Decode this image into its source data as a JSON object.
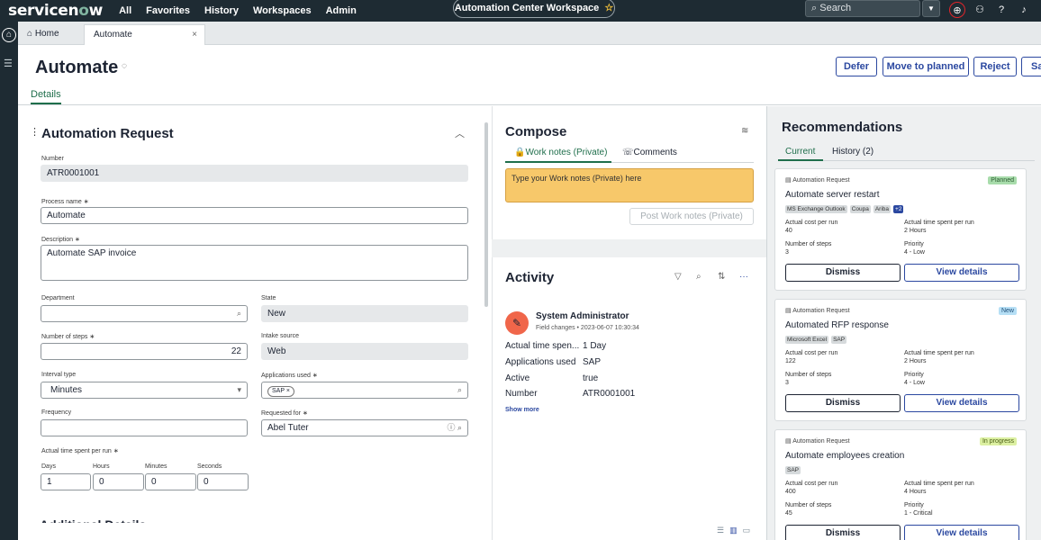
{
  "topnav": {
    "logo_prefix": "servicen",
    "logo_o": "o",
    "logo_suffix": "w",
    "links": [
      "All",
      "Favorites",
      "History",
      "Workspaces",
      "Admin"
    ],
    "workspace": "Automation Center Workspace",
    "star": "☆",
    "search_placeholder": "Search",
    "icons": [
      "globe-icon",
      "chat-icon",
      "help-icon",
      "bell-icon"
    ]
  },
  "tabs": {
    "home": "Home",
    "active": "Automate",
    "close": "×"
  },
  "header": {
    "title": "Automate",
    "buttons": [
      "Defer",
      "Move to planned",
      "Reject",
      "Sa"
    ],
    "details_tab": "Details"
  },
  "form": {
    "section_title": "Automation Request",
    "number_label": "Number",
    "number_value": "ATR0001001",
    "process_label": "Process name",
    "process_value": "Automate",
    "description_label": "Description",
    "description_value": "Automate SAP invoice",
    "department_label": "Department",
    "department_value": "",
    "state_label": "State",
    "state_value": "New",
    "steps_label": "Number of steps",
    "steps_value": "22",
    "intake_label": "Intake source",
    "intake_value": "Web",
    "interval_label": "Interval type",
    "interval_value": "Minutes",
    "apps_label": "Applications used",
    "apps_chip": "SAP",
    "frequency_label": "Frequency",
    "frequency_value": "",
    "requested_label": "Requested for",
    "requested_value": "Abel Tuter",
    "actual_label": "Actual time spent per run",
    "days_label": "Days",
    "days_value": "1",
    "hours_label": "Hours",
    "hours_value": "0",
    "minutes_label": "Minutes",
    "minutes_value": "0",
    "seconds_label": "Seconds",
    "seconds_value": "0",
    "next_section": "Additional Details",
    "required_mark": "∗"
  },
  "compose": {
    "title": "Compose",
    "tab_work_notes": "Work notes (Private)",
    "tab_comments": "Comments",
    "placeholder": "Type your Work notes (Private) here",
    "post_button": "Post Work notes (Private)"
  },
  "activity": {
    "title": "Activity",
    "user": "System Administrator",
    "meta": "Field changes • 2023-06-07 10:30:34",
    "entries": [
      {
        "key": "Actual time spen...",
        "value": "1 Day"
      },
      {
        "key": "Applications used",
        "value": "SAP"
      },
      {
        "key": "Active",
        "value": "true"
      },
      {
        "key": "Number",
        "value": "ATR0001001"
      }
    ],
    "show_more": "Show more"
  },
  "recommendations": {
    "title": "Recommendations",
    "tab_current": "Current",
    "tab_history": "History (2)",
    "cards": [
      {
        "type": "Automation Request",
        "badge": "Planned",
        "title": "Automate server restart",
        "apps": [
          "MS Exchange Outlook",
          "Coupa",
          "Ariba",
          "+2"
        ],
        "cost_label": "Actual cost per run",
        "cost": "40",
        "time_label": "Actual time spent per run",
        "time": "2 Hours",
        "steps_label": "Number of steps",
        "steps": "3",
        "priority_label": "Priority",
        "priority": "4 - Low",
        "dismiss": "Dismiss",
        "view": "View details"
      },
      {
        "type": "Automation Request",
        "badge": "New",
        "title": "Automated RFP response",
        "apps": [
          "Microsoft Excel",
          "SAP"
        ],
        "cost_label": "Actual cost per run",
        "cost": "122",
        "time_label": "Actual time spent per run",
        "time": "2 Hours",
        "steps_label": "Number of steps",
        "steps": "3",
        "priority_label": "Priority",
        "priority": "4 - Low",
        "dismiss": "Dismiss",
        "view": "View details"
      },
      {
        "type": "Automation Request",
        "badge": "In progress",
        "title": "Automate employees creation",
        "apps": [
          "SAP"
        ],
        "cost_label": "Actual cost per run",
        "cost": "400",
        "time_label": "Actual time spent per run",
        "time": "4 Hours",
        "steps_label": "Number of steps",
        "steps": "45",
        "priority_label": "Priority",
        "priority": "1 - Critical",
        "dismiss": "Dismiss",
        "view": "View details"
      }
    ]
  }
}
